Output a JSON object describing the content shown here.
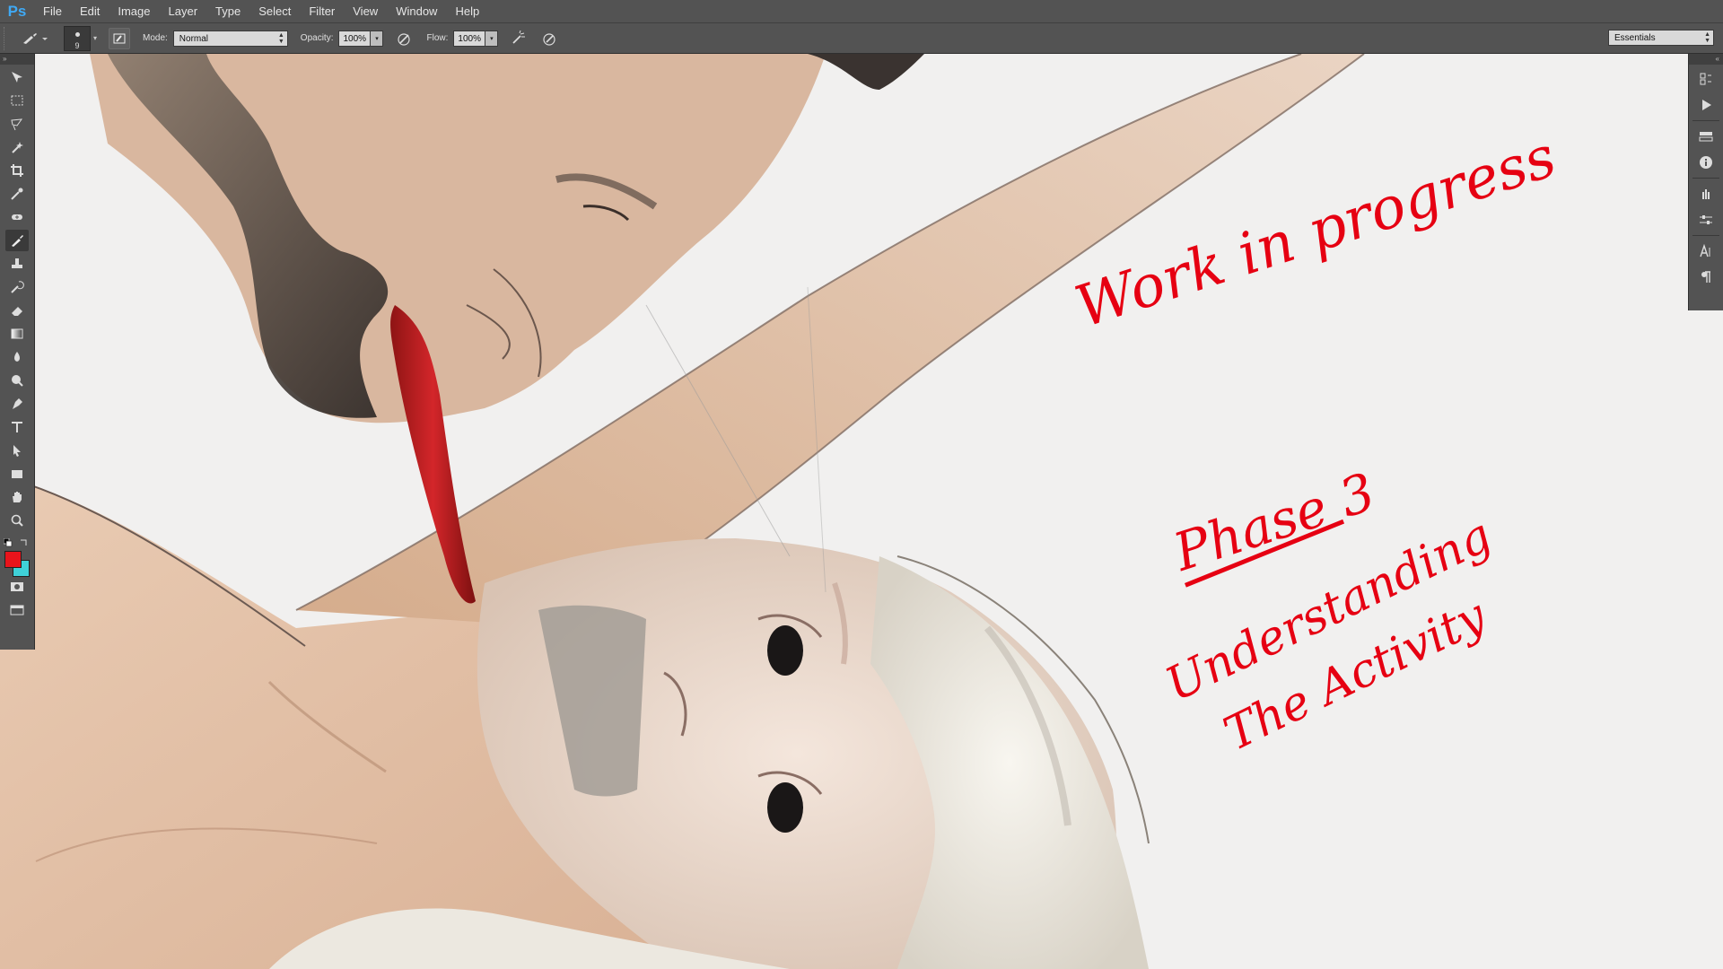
{
  "app": {
    "logo": "Ps"
  },
  "menu": [
    "File",
    "Edit",
    "Image",
    "Layer",
    "Type",
    "Select",
    "Filter",
    "View",
    "Window",
    "Help"
  ],
  "options": {
    "brush_size": "9",
    "mode_label": "Mode:",
    "mode_value": "Normal",
    "opacity_label": "Opacity:",
    "opacity_value": "100%",
    "flow_label": "Flow:",
    "flow_value": "100%",
    "workspace": "Essentials"
  },
  "colors": {
    "foreground": "#e8141b",
    "background": "#3fd1d8",
    "annotation": "#e60012"
  },
  "canvas": {
    "annotations": [
      "Work in progress",
      "Phase 3",
      "Understanding",
      "The Activity"
    ]
  },
  "tools": [
    "move-tool-icon",
    "marquee-tool-icon",
    "lasso-tool-icon",
    "magic-wand-tool-icon",
    "crop-tool-icon",
    "eyedropper-tool-icon",
    "spot-healing-tool-icon",
    "brush-tool-icon",
    "clone-stamp-tool-icon",
    "history-brush-tool-icon",
    "eraser-tool-icon",
    "gradient-tool-icon",
    "blur-tool-icon",
    "dodge-tool-icon",
    "pen-tool-icon",
    "type-tool-icon",
    "path-selection-tool-icon",
    "rectangle-tool-icon",
    "hand-tool-icon",
    "zoom-tool-icon"
  ],
  "dock": [
    "history-panel-icon",
    "actions-panel-icon",
    "properties-panel-icon",
    "info-panel-icon",
    "brush-presets-panel-icon",
    "adjustments-panel-icon",
    "character-panel-icon",
    "paragraph-panel-icon"
  ]
}
